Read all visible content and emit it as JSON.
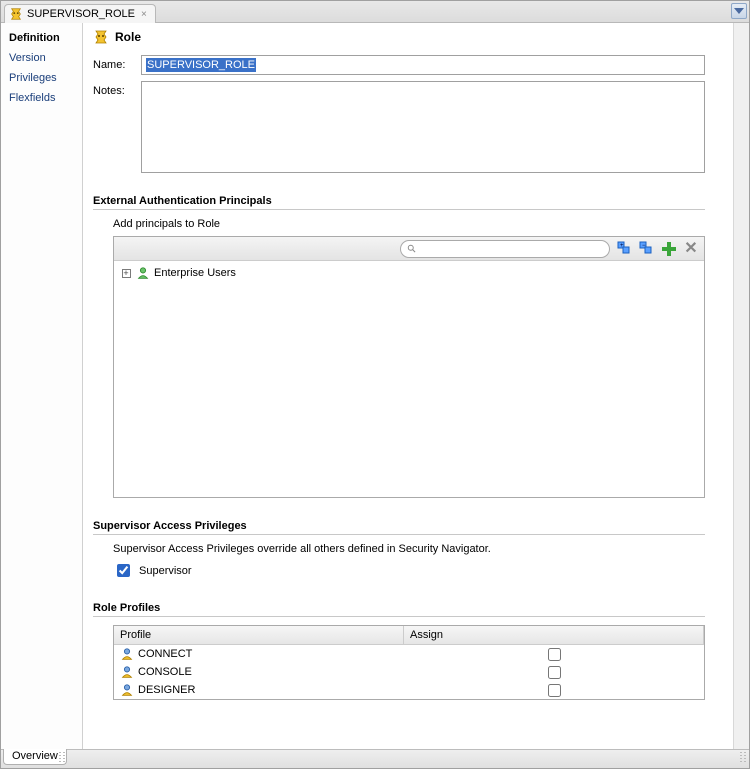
{
  "top_tab": {
    "label": "SUPERVISOR_ROLE"
  },
  "side_nav": {
    "items": [
      {
        "label": "Definition",
        "active": true
      },
      {
        "label": "Version"
      },
      {
        "label": "Privileges"
      },
      {
        "label": "Flexfields"
      }
    ]
  },
  "role": {
    "title": "Role",
    "name_label": "Name:",
    "name_value": "SUPERVISOR_ROLE",
    "notes_label": "Notes:",
    "notes_value": ""
  },
  "ext_auth": {
    "title": "External Authentication Principals",
    "subtext": "Add principals to Role",
    "search_placeholder": "",
    "tree_root": "Enterprise Users"
  },
  "supervisor": {
    "title": "Supervisor Access Privileges",
    "desc": "Supervisor Access Privileges override all others defined in Security Navigator.",
    "checkbox_label": "Supervisor",
    "checked": true
  },
  "profiles": {
    "title": "Role Profiles",
    "header_profile": "Profile",
    "header_assign": "Assign",
    "rows": [
      {
        "name": "CONNECT",
        "assigned": false
      },
      {
        "name": "CONSOLE",
        "assigned": false
      },
      {
        "name": "DESIGNER",
        "assigned": false
      }
    ]
  },
  "bottom": {
    "tab": "Overview"
  }
}
